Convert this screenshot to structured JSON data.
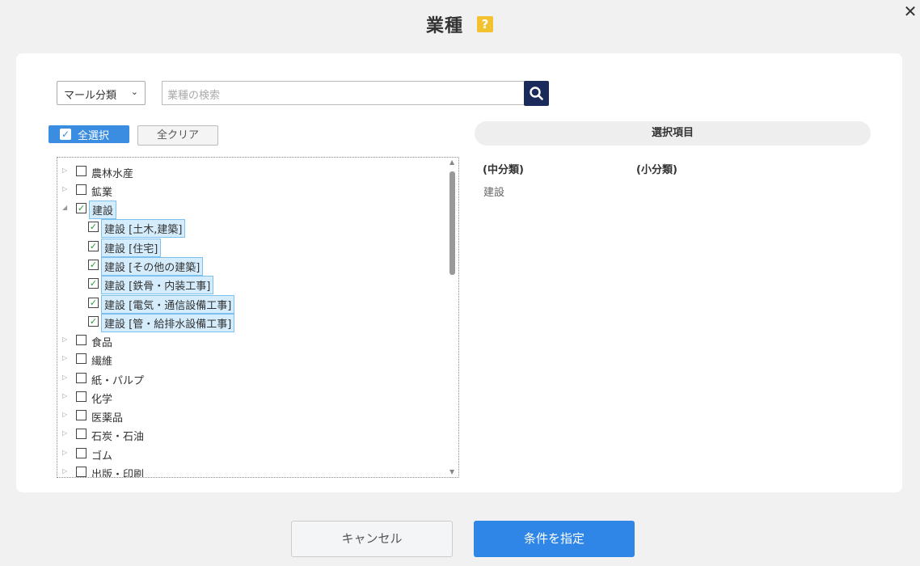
{
  "header": {
    "title": "業種",
    "help_label": "?",
    "close_label": "✕"
  },
  "filters": {
    "select_value": "マール分類",
    "search_placeholder": "業種の検索",
    "select_all_label": "全選択",
    "clear_all_label": "全クリア"
  },
  "tree": {
    "items": [
      {
        "label": "農林水産",
        "level": 0,
        "checked": false,
        "expanded": false,
        "selected": false
      },
      {
        "label": "鉱業",
        "level": 0,
        "checked": false,
        "expanded": false,
        "selected": false
      },
      {
        "label": "建設",
        "level": 0,
        "checked": true,
        "expanded": true,
        "selected": true
      },
      {
        "label": "建設 [土木,建築]",
        "level": 1,
        "checked": true,
        "expanded": false,
        "selected": true
      },
      {
        "label": "建設 [住宅]",
        "level": 1,
        "checked": true,
        "expanded": false,
        "selected": true
      },
      {
        "label": "建設 [その他の建築]",
        "level": 1,
        "checked": true,
        "expanded": false,
        "selected": true
      },
      {
        "label": "建設 [鉄骨・内装工事]",
        "level": 1,
        "checked": true,
        "expanded": false,
        "selected": true
      },
      {
        "label": "建設 [電気・通信設備工事]",
        "level": 1,
        "checked": true,
        "expanded": false,
        "selected": true
      },
      {
        "label": "建設 [管・給排水設備工事]",
        "level": 1,
        "checked": true,
        "expanded": false,
        "selected": true
      },
      {
        "label": "食品",
        "level": 0,
        "checked": false,
        "expanded": false,
        "selected": false
      },
      {
        "label": "繊維",
        "level": 0,
        "checked": false,
        "expanded": false,
        "selected": false
      },
      {
        "label": "紙・パルプ",
        "level": 0,
        "checked": false,
        "expanded": false,
        "selected": false
      },
      {
        "label": "化学",
        "level": 0,
        "checked": false,
        "expanded": false,
        "selected": false
      },
      {
        "label": "医薬品",
        "level": 0,
        "checked": false,
        "expanded": false,
        "selected": false
      },
      {
        "label": "石炭・石油",
        "level": 0,
        "checked": false,
        "expanded": false,
        "selected": false
      },
      {
        "label": "ゴム",
        "level": 0,
        "checked": false,
        "expanded": false,
        "selected": false
      },
      {
        "label": "出版・印刷",
        "level": 0,
        "checked": false,
        "expanded": false,
        "selected": false
      }
    ]
  },
  "selection": {
    "header": "選択項目",
    "col_mid": "(中分類)",
    "col_small": "(小分類)",
    "mid_value": "建設"
  },
  "footer": {
    "cancel_label": "キャンセル",
    "submit_label": "条件を指定"
  },
  "colors": {
    "accent": "#2f86e6",
    "search_button": "#1a2a5a",
    "help_icon": "#f2c230",
    "selected_bg": "#d4ecfb"
  }
}
